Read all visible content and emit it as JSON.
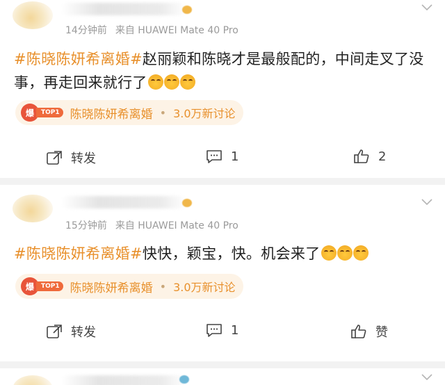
{
  "posts": [
    {
      "time": "14分钟前",
      "source": "来自 HUAWEI Mate 40 Pro",
      "hashtag": "#陈晓陈妍希离婚#",
      "text": "赵丽颖和陈晓才是最般配的，中间走叉了没事，再走回来就行了",
      "emoji_count": 3,
      "topic_badge": "爆",
      "topic_rank": "TOP1",
      "topic_title": "陈晓陈妍希离婚",
      "topic_sep": "•",
      "topic_count": "3.0万新讨论",
      "repost_label": "转发",
      "comment_count": "1",
      "like_label": "2"
    },
    {
      "time": "15分钟前",
      "source": "来自 HUAWEI Mate 40 Pro",
      "hashtag": "#陈晓陈妍希离婚#",
      "text": "快快，颖宝，快。机会来了",
      "emoji_count": 3,
      "topic_badge": "爆",
      "topic_rank": "TOP1",
      "topic_title": "陈晓陈妍希离婚",
      "topic_sep": "•",
      "topic_count": "3.0万新讨论",
      "repost_label": "转发",
      "comment_count": "1",
      "like_label": "赞"
    }
  ],
  "colors": {
    "accent": "#e8902c",
    "meta": "#9a9a9a",
    "pill_bg": "#fdf3e6",
    "badge": "#e8543a"
  },
  "icons": [
    "chevron-down-icon",
    "repost-icon",
    "comment-icon",
    "like-icon",
    "smile-emoji-icon"
  ]
}
